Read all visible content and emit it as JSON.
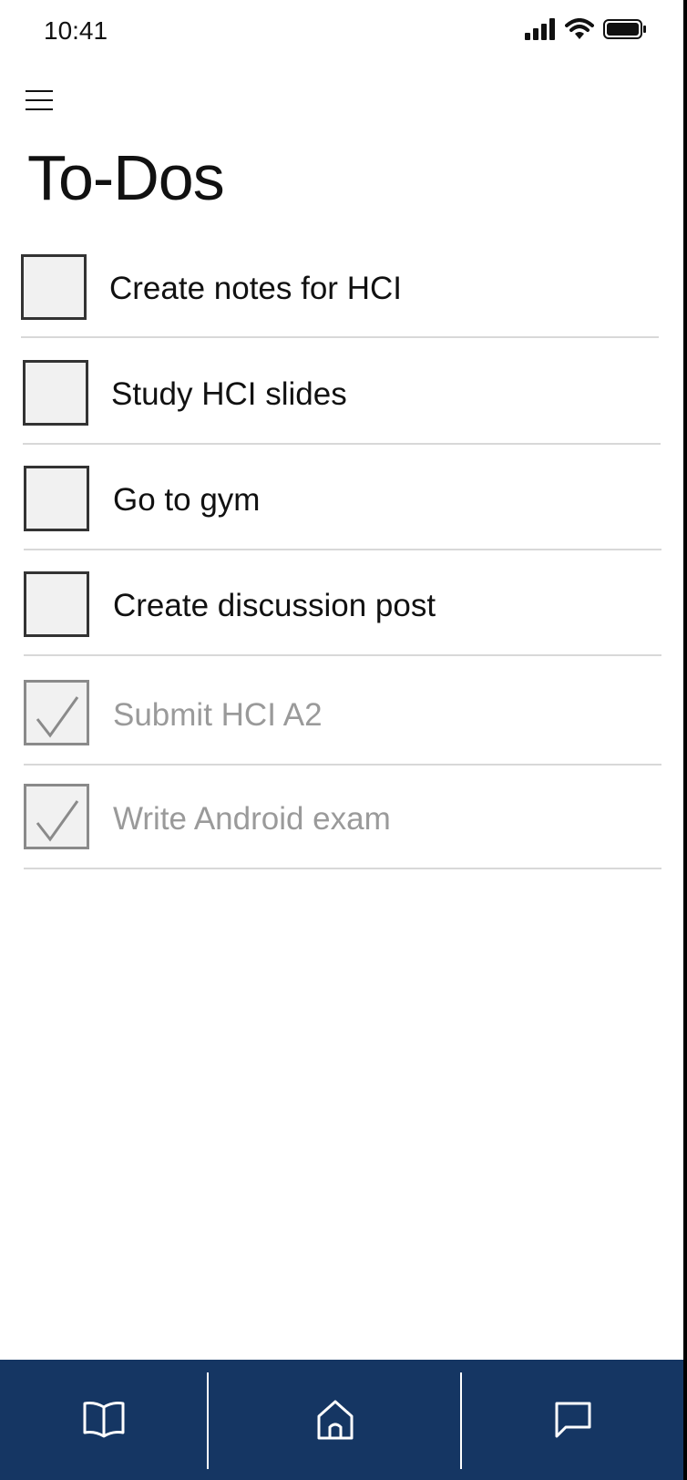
{
  "status_bar": {
    "time": "10:41",
    "icons": [
      "cellular-signal-icon",
      "wifi-icon",
      "battery-icon"
    ]
  },
  "header": {
    "menu_icon": "hamburger-menu-icon",
    "title": "To-Dos"
  },
  "todos": [
    {
      "label": "Create notes for HCI",
      "checked": false
    },
    {
      "label": "Study HCI slides",
      "checked": false
    },
    {
      "label": "Go to gym",
      "checked": false
    },
    {
      "label": "Create discussion post",
      "checked": false
    },
    {
      "label": "Submit HCI A2",
      "checked": true
    },
    {
      "label": "Write Android exam",
      "checked": true
    }
  ],
  "bottom_nav": {
    "items": [
      {
        "icon": "book-icon"
      },
      {
        "icon": "home-icon"
      },
      {
        "icon": "chat-bubble-icon"
      }
    ]
  },
  "colors": {
    "nav_background": "#153663",
    "done_text": "#9a9a9a",
    "checkbox_border": "#333333",
    "checkbox_fill": "#f1f1f1"
  }
}
